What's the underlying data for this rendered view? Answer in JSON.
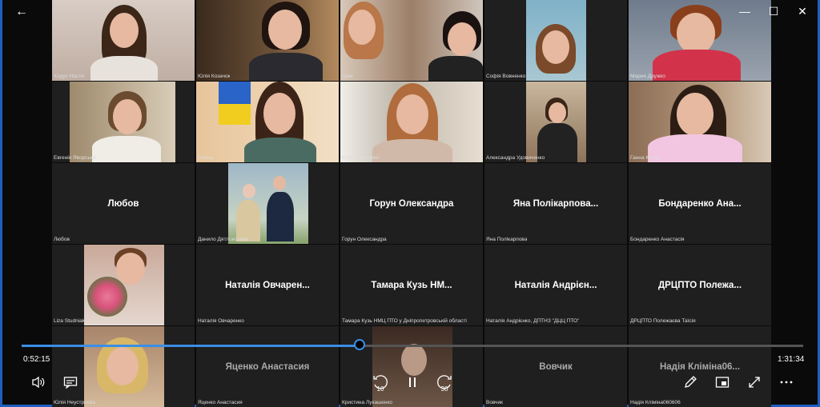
{
  "window": {
    "back_label": "←",
    "minimize": "—",
    "maximize": "☐",
    "close": "✕"
  },
  "tiles": [
    {
      "caption": "Ходус Настя"
    },
    {
      "caption": "Юлія Козачок"
    },
    {
      "caption": "User"
    },
    {
      "caption": "Софія Вовненко"
    },
    {
      "caption": "Мария Дружко"
    },
    {
      "caption": "Евгенія Яворська"
    },
    {
      "caption": "Darina"
    },
    {
      "caption": "Юлія Корнієнко"
    },
    {
      "caption": "Александра Удовиченко"
    },
    {
      "caption": "Ганна Клець"
    },
    {
      "name": "Любов",
      "caption": "Любов"
    },
    {
      "caption": "Данило Дятловський"
    },
    {
      "name": "Горун Олександра",
      "caption": "Горун Олександра"
    },
    {
      "name": "Яна Полікарпова...",
      "caption": "Яна Полікарпова"
    },
    {
      "name": "Бондаренко Ана...",
      "caption": "Бондаренко Анастасія"
    },
    {
      "caption": "Liza Studniak"
    },
    {
      "name": "Наталія Овчарен...",
      "caption": "Наталія Овчаренко"
    },
    {
      "name": "Тамара Кузь НМ...",
      "caption": "Тамара Кузь НМЦ ПТО у Дніпропетровській області"
    },
    {
      "name": "Наталія Андрієн...",
      "caption": "Наталія Андрієнко, ДПТНЗ \"ДЦЦ ПТО\""
    },
    {
      "name": "ДРЦПТО Полежа...",
      "caption": "ДРЦПТО Полежаєва Таїсія"
    },
    {
      "caption": "Юлія Неустроєва"
    },
    {
      "name": "Яценко Анастасия",
      "caption": "Яценко Анастасия"
    },
    {
      "caption": "Кристина Лукашенко"
    },
    {
      "name": "Вовчик",
      "caption": "Вовчик"
    },
    {
      "name": "Надія Кліміна06...",
      "caption": "Надія Кліміна060606"
    }
  ],
  "player": {
    "elapsed": "0:52:15",
    "total": "1:31:34",
    "progress": 0.432,
    "volume_icon": "volume-icon",
    "captions_icon": "captions-icon",
    "rewind_label": "10",
    "forward_label": "30"
  }
}
